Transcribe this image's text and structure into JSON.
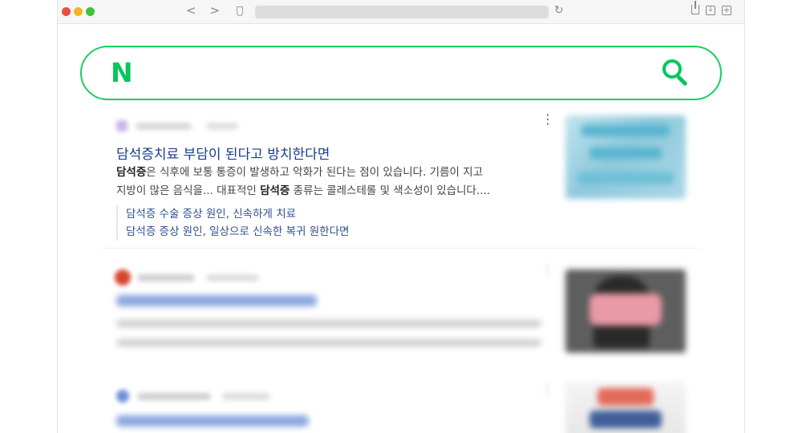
{
  "browser": {
    "nav_arrows": "< >",
    "reload_glyph": "↻",
    "download_glyph": "↓",
    "newtab_glyph": "+"
  },
  "search": {
    "logo": "N",
    "logo_color": "#03c75a",
    "icon": "search-icon"
  },
  "results": [
    {
      "source_name": "",
      "date": "",
      "title": "담석증치료 부담이 된다고 방치한다면",
      "snippet_lines": [
        {
          "bold": "담석증",
          "text": "은 식후에 보통 통증이 발생하고 악화가 된다는 점이 있습니다. 기름이 지고"
        },
        {
          "pre": "지방이 많은 음식을... 대표적인 ",
          "bold": "담석증",
          "text": " 종류는 콜레스테롤 및 색소성이 있습니다...."
        }
      ],
      "sublinks": [
        "담석증 수술 증상 원인, 신속하게 치료",
        "담석증 증상 원인, 일상으로 신속한 복귀 원한다면"
      ]
    }
  ]
}
